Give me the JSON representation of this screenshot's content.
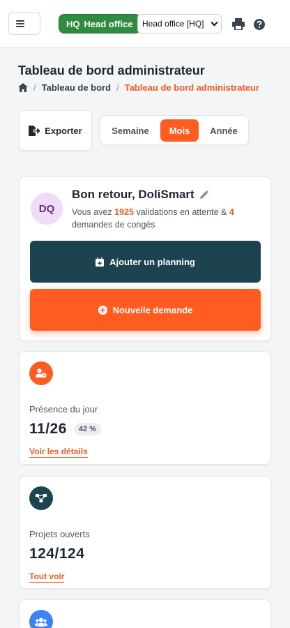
{
  "header": {
    "menu_icon": "hamburger-icon",
    "hq_badge": "HQ",
    "hq_badge_label": "Head office",
    "office_select_value": "Head office [HQ]",
    "print_icon": "print-icon",
    "help_icon": "question-circle-icon"
  },
  "page": {
    "title": "Tableau de bord administrateur",
    "breadcrumb": {
      "home_icon": "home-icon",
      "item1": "Tableau de bord",
      "separator": "/",
      "current": "Tableau de bord administrateur"
    }
  },
  "toolbar": {
    "export_label": "Exporter",
    "export_icon": "file-export-icon",
    "periods": [
      "Semaine",
      "Mois",
      "Année"
    ],
    "active_period": "Mois"
  },
  "welcome": {
    "avatar_initials": "DQ",
    "title": "Bon retour, DoliSmart",
    "edit_icon": "pencil-icon",
    "text_before": "Vous avez ",
    "pending_validations": "1925",
    "text_middle": " validations en attente & ",
    "leave_requests": "4",
    "text_after": " demandes de congés",
    "add_planning_label": "Ajouter un planning",
    "add_planning_icon": "calendar-plus-icon",
    "new_request_label": "Nouvelle demande",
    "new_request_icon": "plus-circle-icon"
  },
  "stats": [
    {
      "icon": "user-clock-icon",
      "icon_color": "#ff5c22",
      "label": "Présence du jour",
      "value": "11/26",
      "badge": "42 %",
      "link": "Voir les détails"
    },
    {
      "icon": "project-diagram-icon",
      "icon_color": "#1d4250",
      "label": "Projets ouverts",
      "value": "124/124",
      "link": "Tout voir"
    },
    {
      "icon": "users-icon",
      "icon_color": "#3b82f6"
    }
  ],
  "colors": {
    "accent": "#ff5c22",
    "primary_dark": "#1d4250",
    "success": "#2e8b3f"
  }
}
